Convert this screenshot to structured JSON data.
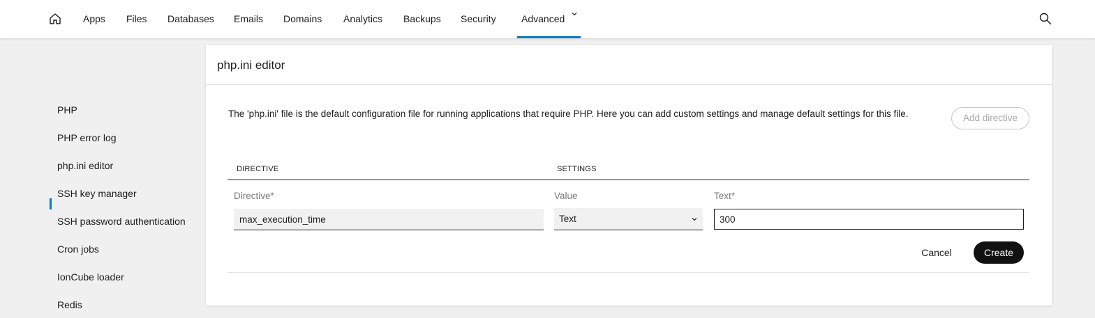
{
  "nav": {
    "home_icon": "home-icon",
    "items": [
      "Apps",
      "Files",
      "Databases",
      "Emails",
      "Domains",
      "Analytics",
      "Backups",
      "Security"
    ],
    "active": "Advanced",
    "search_icon": "search-icon",
    "accent_color": "#0a7bbf"
  },
  "sidebar": {
    "items": [
      "PHP",
      "PHP error log",
      "php.ini editor",
      "SSH key manager",
      "SSH password authentication",
      "Cron jobs",
      "IonCube loader",
      "Redis"
    ],
    "active": "php.ini editor"
  },
  "card": {
    "title": "php.ini editor",
    "description": "The 'php.ini' file is the default configuration file for running applications that require PHP. Here you can add custom settings and manage default settings for this file.",
    "add_button": "Add directive",
    "table": {
      "col_directive": "DIRECTIVE",
      "col_settings": "SETTINGS"
    },
    "form": {
      "directive_label": "Directive*",
      "directive_value": "max_execution_time",
      "value_label": "Value",
      "value_selected": "Text",
      "text_label": "Text*",
      "text_value": "300",
      "cancel": "Cancel",
      "create": "Create"
    }
  }
}
